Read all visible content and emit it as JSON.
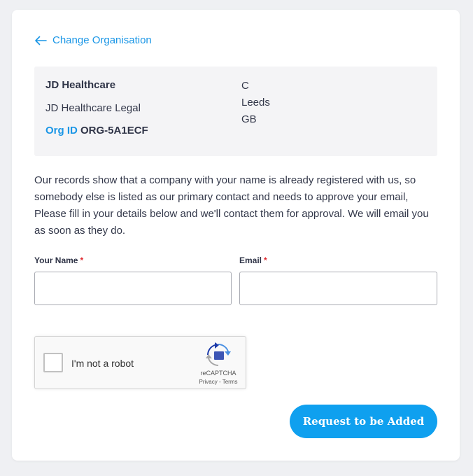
{
  "back_link": {
    "label": "Change Organisation"
  },
  "org": {
    "name": "JD Healthcare",
    "legal_name": "JD Healthcare Legal",
    "id_label": "Org ID",
    "id_value": "ORG-5A1ECF",
    "address": [
      "C",
      "Leeds",
      "GB"
    ]
  },
  "message": "Our records show that a company with your name is already registered with us, so somebody else is listed as our primary contact and needs to approve your email, Please fill in your details below and we'll contact them for approval. We will email you as soon as they do.",
  "form": {
    "name_label": "Your Name",
    "email_label": "Email",
    "required_marker": "*",
    "name_value": "",
    "email_value": ""
  },
  "recaptcha": {
    "label": "I'm not a robot",
    "brand": "reCAPTCHA",
    "terms": "Privacy - Terms"
  },
  "submit": {
    "label": "Request to be Added"
  },
  "colors": {
    "accent": "#1a96e6",
    "button": "#0fa0ef",
    "required": "#e0282e",
    "background": "#eff0f3"
  },
  "icons": {
    "back": "arrow-left-icon",
    "recaptcha": "recaptcha-logo-icon"
  }
}
